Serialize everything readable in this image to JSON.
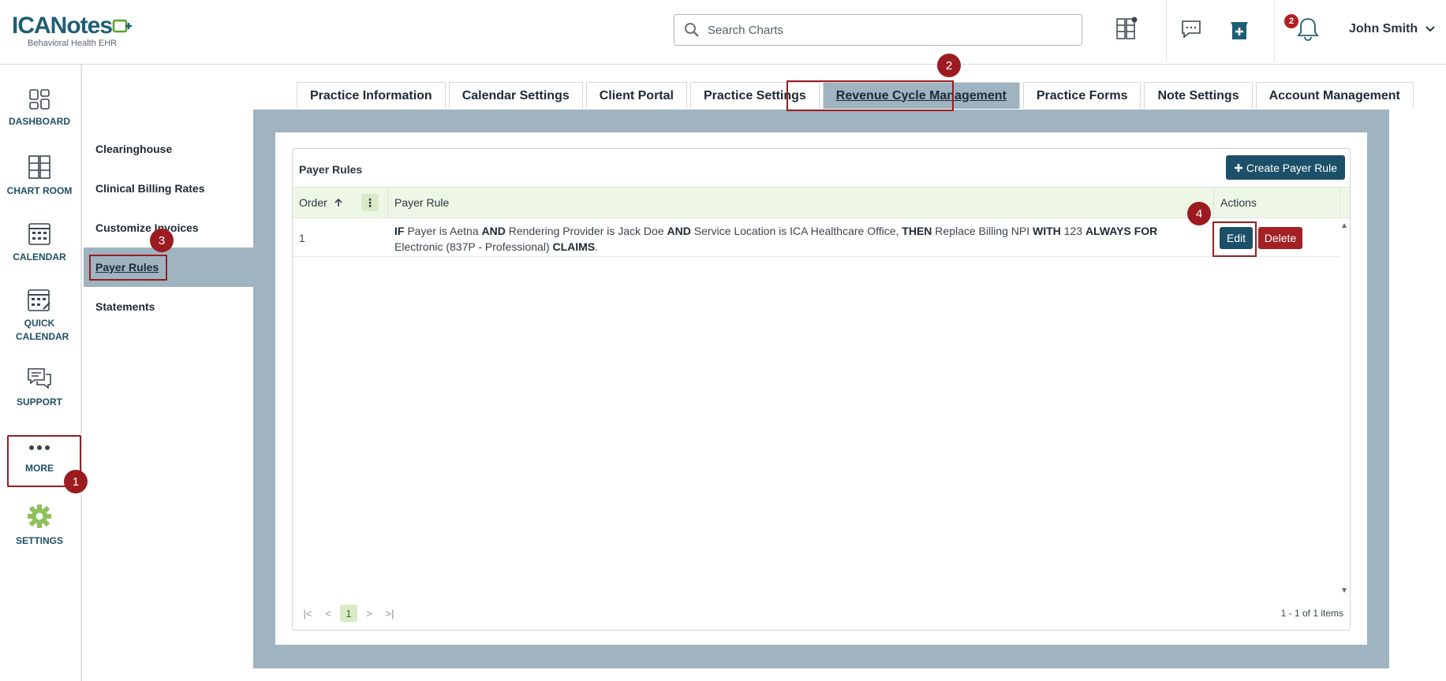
{
  "header": {
    "logo_main": "ICANotes",
    "logo_sub": "Behavioral Health EHR",
    "search_placeholder": "Search Charts",
    "notifications_count": "2",
    "user_name": "John Smith"
  },
  "leftnav": {
    "items": [
      {
        "label": "DASHBOARD"
      },
      {
        "label": "CHART ROOM"
      },
      {
        "label": "CALENDAR"
      },
      {
        "label": "QUICK CALENDAR"
      },
      {
        "label": "SUPPORT"
      },
      {
        "label": "MORE"
      },
      {
        "label": "SETTINGS"
      }
    ]
  },
  "subnav": {
    "items": [
      {
        "label": "Clearinghouse"
      },
      {
        "label": "Clinical Billing Rates"
      },
      {
        "label": "Customize Invoices"
      },
      {
        "label": "Payer Rules"
      },
      {
        "label": "Statements"
      }
    ]
  },
  "tabs": [
    {
      "label": "Practice Information"
    },
    {
      "label": "Calendar Settings"
    },
    {
      "label": "Client Portal"
    },
    {
      "label": "Practice Settings"
    },
    {
      "label": "Revenue Cycle Management"
    },
    {
      "label": "Practice Forms"
    },
    {
      "label": "Note Settings"
    },
    {
      "label": "Account Management"
    }
  ],
  "grid": {
    "title": "Payer Rules",
    "create_label": "Create Payer Rule",
    "columns": {
      "order": "Order",
      "rule": "Payer Rule",
      "actions": "Actions"
    },
    "rows": [
      {
        "order": "1",
        "rule_parts": {
          "if": "IF",
          "t1": " Payer is Aetna ",
          "and1": "AND",
          "t2": " Rendering Provider is Jack Doe ",
          "and2": "AND",
          "t3": " Service Location is ICA Healthcare Office, ",
          "then": "THEN",
          "t4": " Replace Billing NPI ",
          "with": "WITH",
          "t5": " 123 ",
          "always": "ALWAYS FOR",
          "t6": " Electronic (837P - Professional) ",
          "claims": "CLAIMS",
          "t7": "."
        },
        "edit_label": "Edit",
        "delete_label": "Delete"
      }
    ],
    "pager_current": "1",
    "pager_info": "1 - 1 of 1 items"
  },
  "steps": [
    "1",
    "2",
    "3",
    "4"
  ],
  "colors": {
    "accent": "#1c5068",
    "danger": "#a32024",
    "highlight": "#9c1b20",
    "panel": "#9fb3c0",
    "green": "#5f9f2c"
  }
}
